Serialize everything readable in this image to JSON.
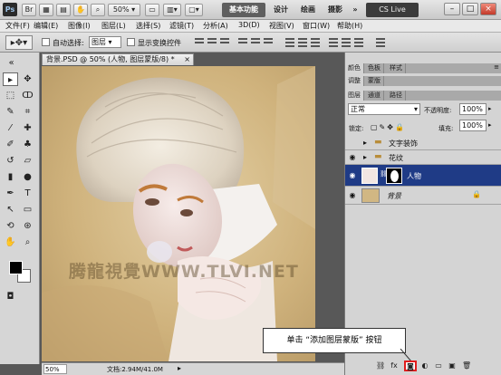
{
  "app": {
    "logo": "Ps",
    "zoom_label": "50%"
  },
  "workspaces": {
    "basic": "基本功能",
    "design": "设计",
    "painting": "绘画",
    "photography": "摄影",
    "more": "»",
    "cslive": "CS Live"
  },
  "menus": [
    "文件(F)",
    "编辑(E)",
    "图像(I)",
    "图层(L)",
    "选择(S)",
    "滤镜(T)",
    "分析(A)",
    "3D(D)",
    "视图(V)",
    "窗口(W)",
    "帮助(H)"
  ],
  "options": {
    "auto_select_label": "自动选择:",
    "auto_select_value": "图层",
    "show_transform_label": "显示变换控件"
  },
  "document": {
    "tab_title": "背景.PSD @ 50% (人物, 图层蒙版/8) *",
    "close": "×",
    "zoom": "50%",
    "doc_info": "文档:2.94M/41.0M",
    "watermark": "腾龍視覺WWW.TLVI.NET"
  },
  "panels": {
    "top_tabs": [
      "颜色",
      "色板",
      "样式"
    ],
    "mid_tabs": [
      "调整",
      "蒙版"
    ],
    "layer_tabs": [
      "图层",
      "通道",
      "路径"
    ],
    "blend_mode": "正常",
    "opacity_label": "不透明度:",
    "opacity_value": "100%",
    "lock_label": "锁定:",
    "fill_label": "填充:",
    "fill_value": "100%",
    "layers": [
      {
        "name": "文字装饰",
        "kind": "group"
      },
      {
        "name": "花纹",
        "kind": "group"
      },
      {
        "name": "人物",
        "kind": "layer",
        "selected": true
      },
      {
        "name": "背景",
        "kind": "background"
      }
    ]
  },
  "tooltip": "单击 “添加图层蒙版” 按钮",
  "colors": {
    "accent": "#1f3b86",
    "highlight": "#e01e1e"
  }
}
